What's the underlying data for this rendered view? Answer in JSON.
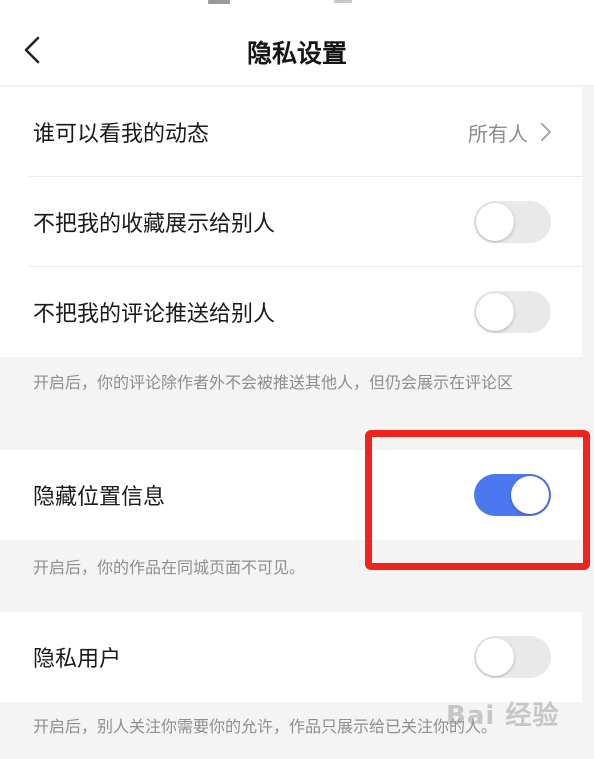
{
  "header": {
    "title": "隐私设置"
  },
  "privacy": {
    "who_can_see": {
      "label": "谁可以看我的动态",
      "value": "所有人"
    },
    "hide_favorites": {
      "label": "不把我的收藏展示给别人",
      "enabled": false
    },
    "hide_comments": {
      "label": "不把我的评论推送给别人",
      "enabled": false,
      "note": "开启后，你的评论除作者外不会被推送其他人，但仍会展示在评论区"
    },
    "hide_location": {
      "label": "隐藏位置信息",
      "enabled": true,
      "note": "开启后，你的作品在同城页面不可见。"
    },
    "private_user": {
      "label": "隐私用户",
      "enabled": false,
      "note": "开启后，别人关注你需要你的允许，作品只展示给已关注你的人。"
    }
  },
  "watermark": "Bai 经验",
  "colors": {
    "switch_on": "#4b78ef",
    "switch_off": "#e9e9ea",
    "highlight": "#f0231d"
  }
}
